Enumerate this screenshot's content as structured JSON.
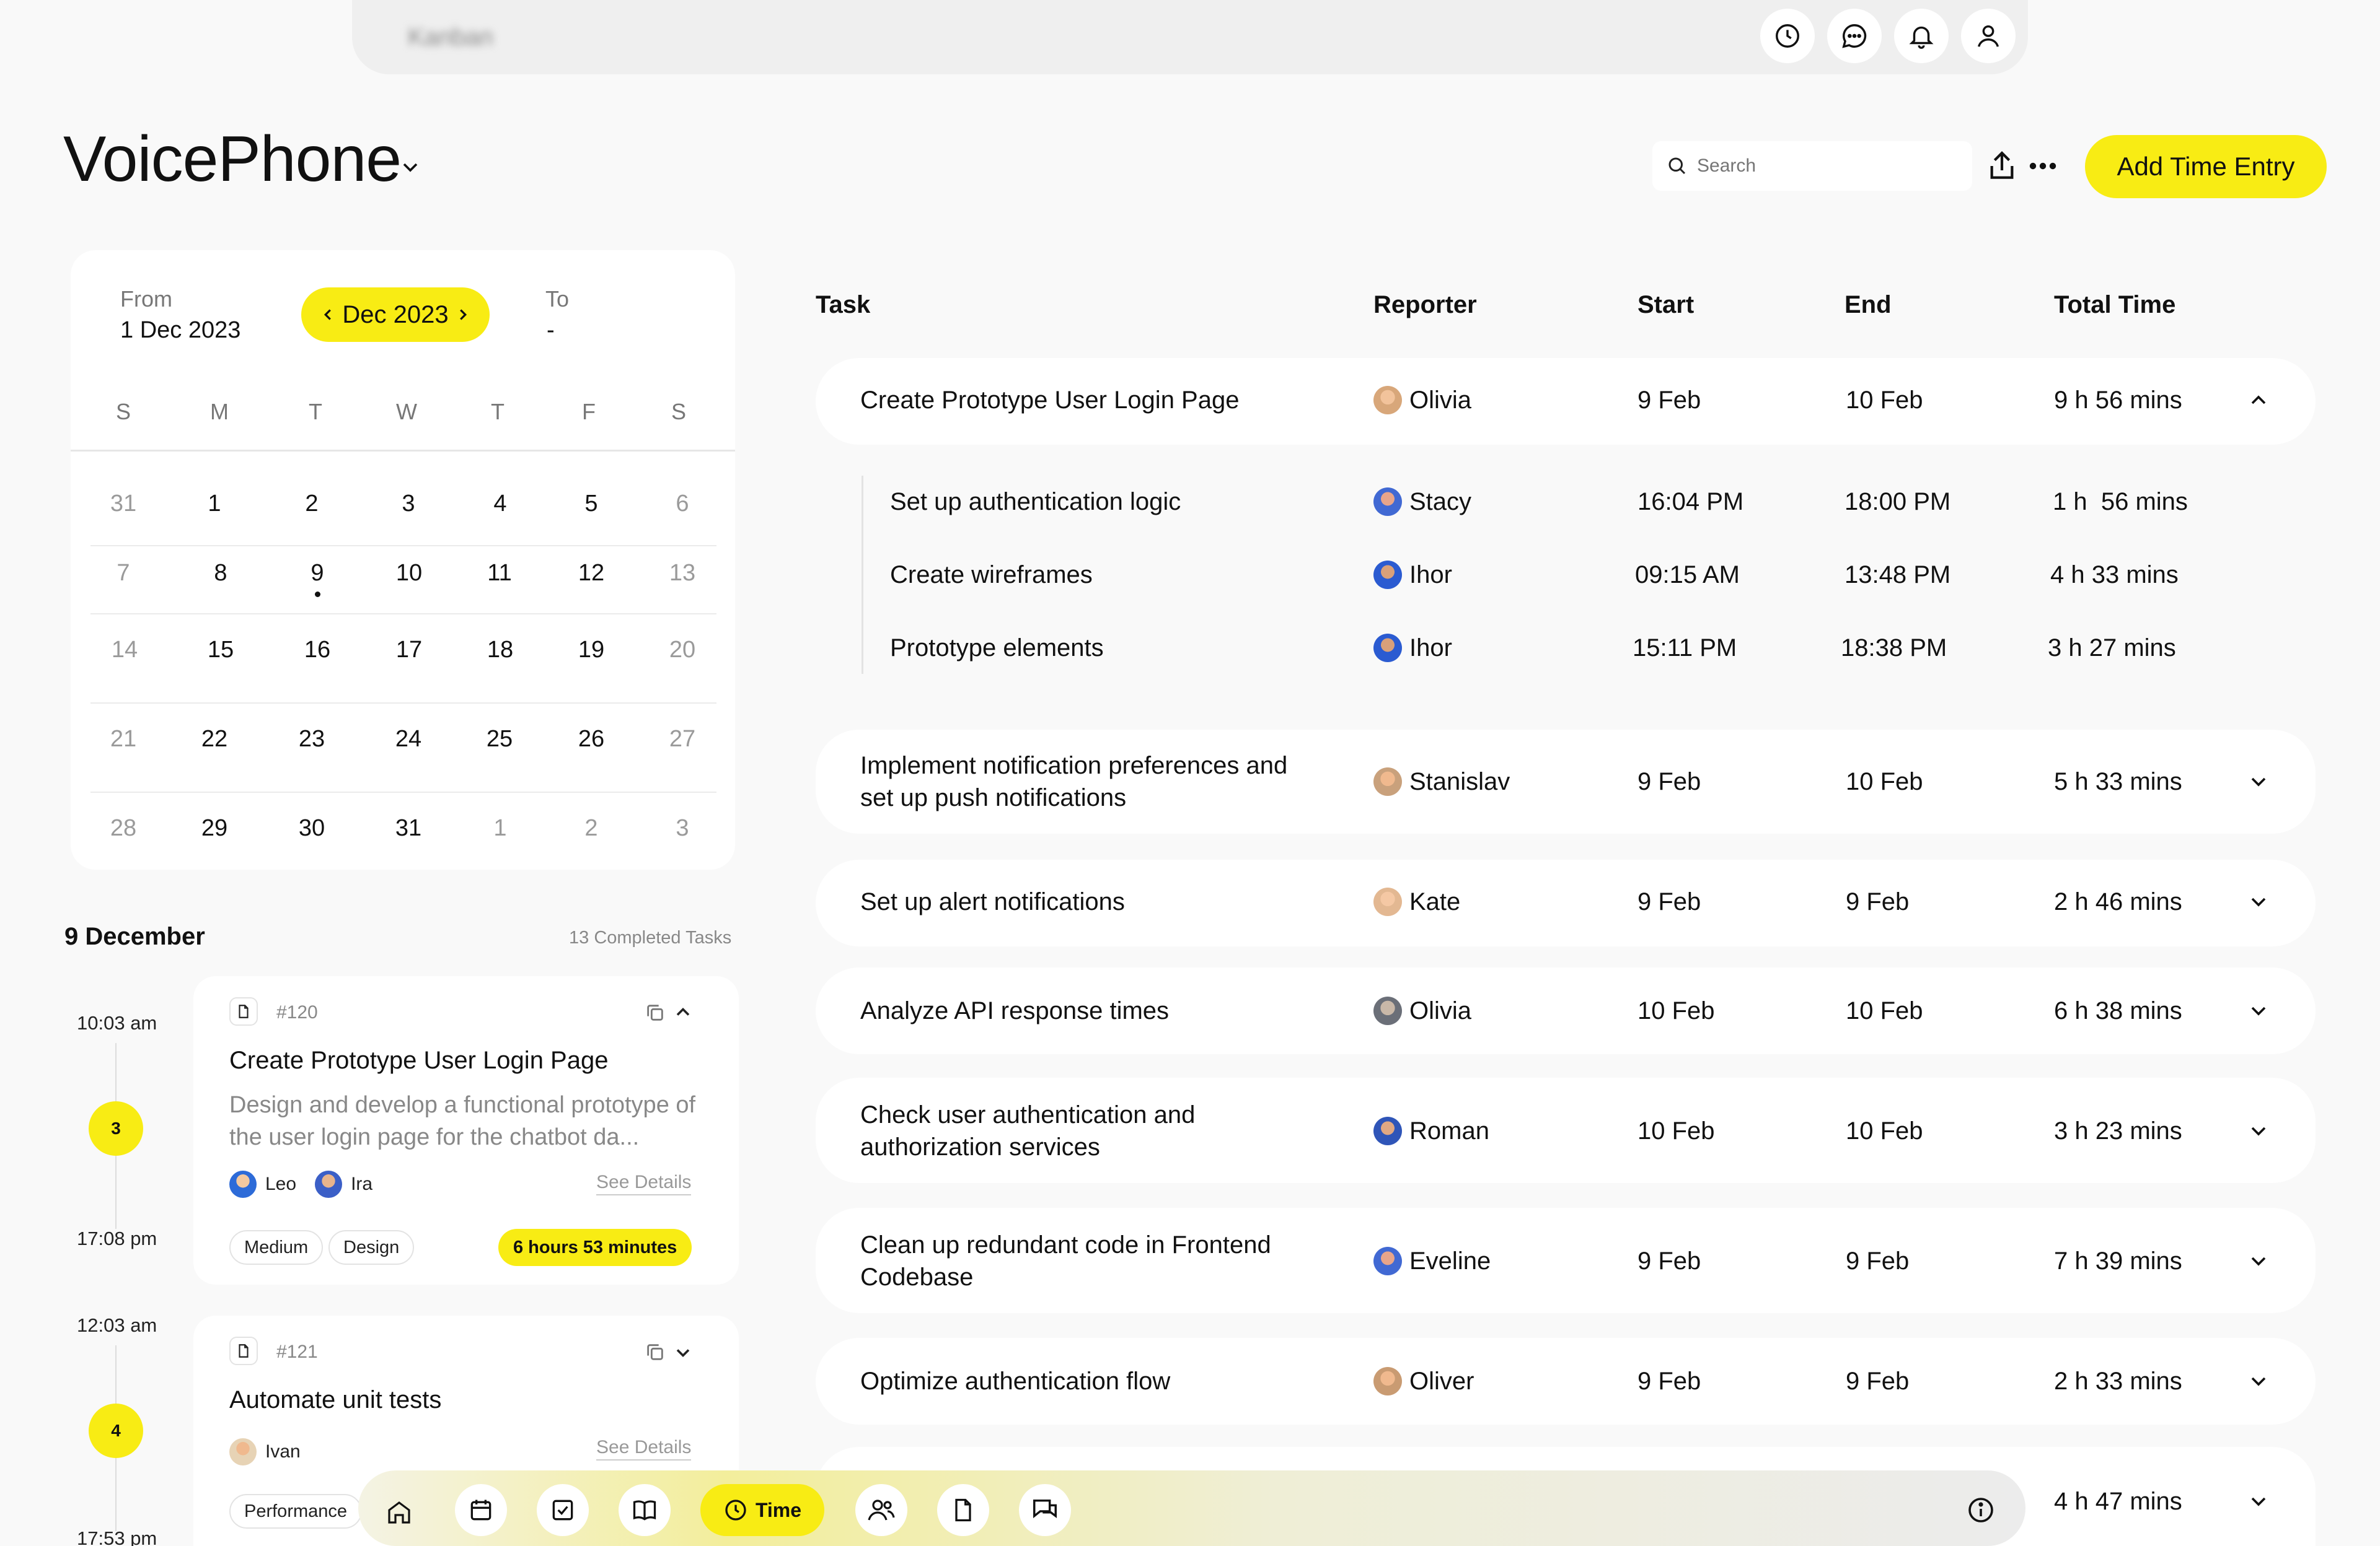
{
  "topbar": {
    "title": "Kanban",
    "icons": [
      "clock-icon",
      "chat-icon",
      "bell-icon",
      "user-icon"
    ]
  },
  "header": {
    "project": "VoicePhone",
    "search_placeholder": "Search",
    "add_button": "Add Time Entry"
  },
  "calendar": {
    "from_label": "From",
    "from_value": "1 Dec 2023",
    "to_label": "To",
    "to_value": "-",
    "month": "Dec 2023",
    "weekdays": [
      "S",
      "M",
      "T",
      "W",
      "T",
      "F",
      "S"
    ],
    "weeks": [
      [
        "31",
        "1",
        "2",
        "3",
        "4",
        "5",
        "6"
      ],
      [
        "7",
        "8",
        "9",
        "10",
        "11",
        "12",
        "13"
      ],
      [
        "14",
        "15",
        "16",
        "17",
        "18",
        "19",
        "20"
      ],
      [
        "21",
        "22",
        "23",
        "24",
        "25",
        "26",
        "27"
      ],
      [
        "28",
        "29",
        "30",
        "31",
        "1",
        "2",
        "3"
      ]
    ],
    "selected_day": "9"
  },
  "day_list": {
    "date": "9 December",
    "completed": "13 Completed Tasks",
    "entries": [
      {
        "start": "10:03 am",
        "end": "17:08 pm",
        "count": "3",
        "id": "#120",
        "title": "Create Prototype User Login Page",
        "desc": "Design and develop a functional prototype of the user login page for the chatbot da...",
        "people": [
          "Leo",
          "Ira"
        ],
        "see_details": "See Details",
        "tags": [
          "Medium",
          "Design"
        ],
        "duration": "6 hours 53 minutes"
      },
      {
        "start": "12:03 am",
        "end": "17:53 pm",
        "count": "4",
        "id": "#121",
        "title": "Automate unit tests",
        "people": [
          "Ivan"
        ],
        "see_details": "See Details",
        "tags": [
          "Performance"
        ]
      }
    ]
  },
  "table": {
    "headers": {
      "task": "Task",
      "reporter": "Reporter",
      "start": "Start",
      "end": "End",
      "total": "Total Time"
    },
    "rows": [
      {
        "task": "Create Prototype User Login Page",
        "reporter": "Olivia",
        "start": "9 Feb",
        "end": "10 Feb",
        "total": "9 h 56 mins",
        "expanded": true,
        "subtasks": [
          {
            "task": "Set up authentication logic",
            "reporter": "Stacy",
            "start": "16:04 PM",
            "end": "18:00 PM",
            "total": "1 h  56 mins"
          },
          {
            "task": "Create wireframes",
            "reporter": "Ihor",
            "start": "09:15 AM",
            "end": "13:48 PM",
            "total": "4 h 33 mins"
          },
          {
            "task": "Prototype elements",
            "reporter": "Ihor",
            "start": "15:11 PM",
            "end": "18:38 PM",
            "total": "3 h 27 mins"
          }
        ]
      },
      {
        "task_line1": "Implement notification preferences and",
        "task_line2": "set up push notifications",
        "reporter": "Stanislav",
        "start": "9 Feb",
        "end": "10 Feb",
        "total": "5 h 33 mins"
      },
      {
        "task": "Set up alert notifications",
        "reporter": "Kate",
        "start": "9 Feb",
        "end": "9 Feb",
        "total": "2 h 46 mins"
      },
      {
        "task": "Analyze API response times",
        "reporter": "Olivia",
        "start": "10 Feb",
        "end": "10 Feb",
        "total": "6 h 38 mins"
      },
      {
        "task_line1": "Check user authentication and",
        "task_line2": "authorization services",
        "reporter": "Roman",
        "start": "10 Feb",
        "end": "10 Feb",
        "total": "3 h 23 mins"
      },
      {
        "task_line1": "Clean up redundant code in Frontend",
        "task_line2": "Codebase",
        "reporter": "Eveline",
        "start": "9 Feb",
        "end": "9 Feb",
        "total": "7 h 39 mins"
      },
      {
        "task": "Optimize authentication flow",
        "reporter": "Oliver",
        "start": "9 Feb",
        "end": "9 Feb",
        "total": "2 h 33 mins"
      },
      {
        "total": "4 h 47 mins"
      }
    ]
  },
  "bottom_nav": {
    "items": [
      "home-icon",
      "calendar-icon",
      "checkbox-icon",
      "book-icon",
      "time",
      "people-icon",
      "document-icon",
      "messages-icon"
    ],
    "active_label": "Time",
    "info": "info-icon"
  },
  "colors": {
    "accent": "#f8ec14",
    "background": "#f9f9f9",
    "card": "#ffffff"
  }
}
